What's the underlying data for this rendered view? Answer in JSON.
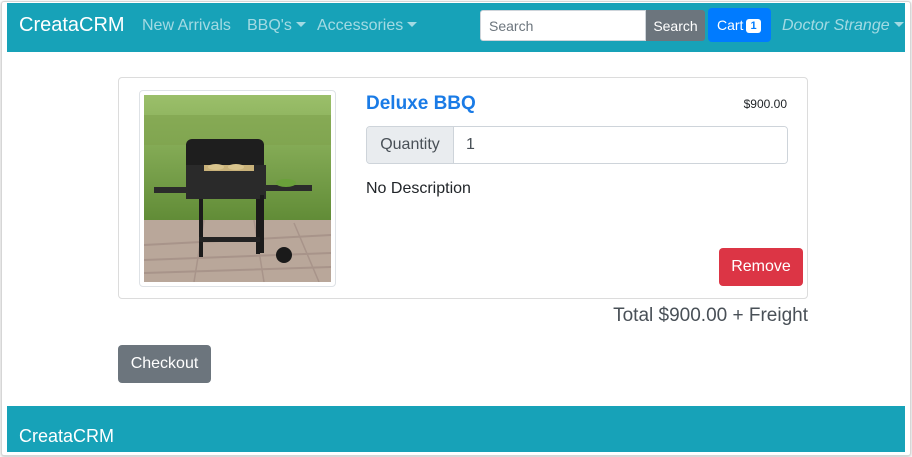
{
  "nav": {
    "brand": "CreataCRM",
    "links": [
      {
        "label": "New Arrivals"
      },
      {
        "label": "BBQ's"
      },
      {
        "label": "Accessories"
      }
    ],
    "search_placeholder": "Search",
    "search_button": "Search",
    "cart_label": "Cart",
    "cart_count": "1",
    "user": "Doctor Strange"
  },
  "cart": {
    "items": [
      {
        "title": "Deluxe BBQ",
        "price": "$900.00",
        "quantity_label": "Quantity",
        "quantity": "1",
        "description": "No Description",
        "remove_label": "Remove"
      }
    ],
    "total": "Total $900.00 + Freight",
    "checkout_label": "Checkout"
  },
  "footer": {
    "brand": "CreataCRM"
  },
  "colors": {
    "navbar": "#17a2b8",
    "link": "#1a7be6",
    "danger": "#dc3545",
    "secondary": "#6c757d",
    "primary": "#007bff"
  }
}
